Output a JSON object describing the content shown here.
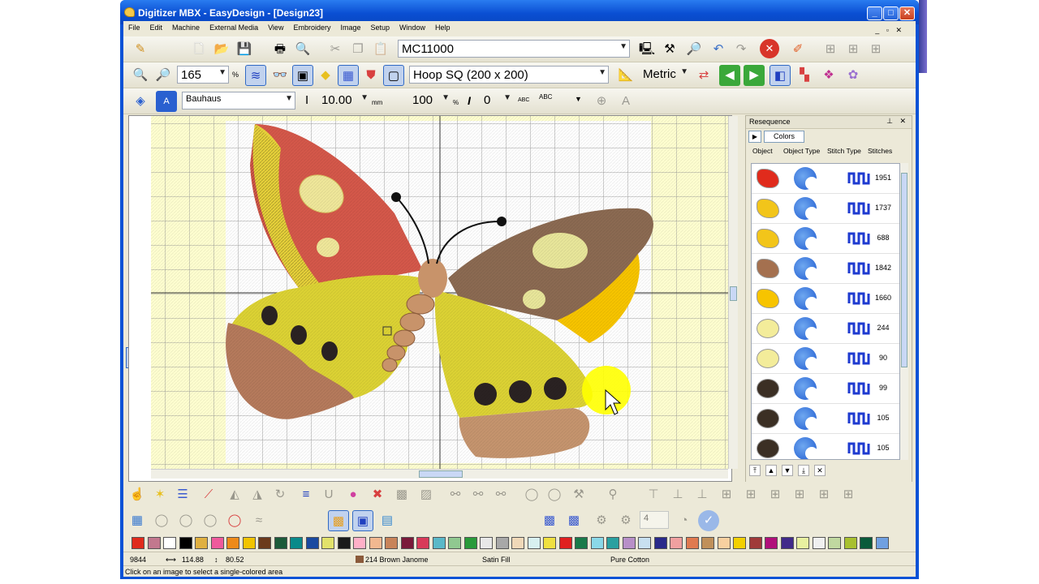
{
  "window": {
    "title": "Digitizer MBX - EasyDesign - [Design23]",
    "menu": [
      "File",
      "Edit",
      "Machine",
      "External Media",
      "View",
      "Embroidery",
      "Image",
      "Setup",
      "Window",
      "Help"
    ]
  },
  "toolbar": {
    "machine": "MC11000",
    "zoom": "165",
    "zoom_unit": "%",
    "hoop": "Hoop SQ (200 x 200)",
    "units": "Metric",
    "font": "Bauhaus",
    "letter_height": "10.00",
    "letter_height_unit": "mm",
    "letter_width": "100",
    "letter_width_unit": "%",
    "italic_label": "I",
    "italic_value": "0",
    "abc1": "ABC",
    "abc2": "ABC"
  },
  "panel": {
    "title": "Resequence",
    "tab": "Colors",
    "columns": [
      "Object",
      "Object Type",
      "Stitch Type",
      "Stitches"
    ],
    "rows": [
      {
        "stitches": "1951",
        "color": "#e02b1c"
      },
      {
        "stitches": "1737",
        "color": "#f2c51a"
      },
      {
        "stitches": "688",
        "color": "#f2c51a"
      },
      {
        "stitches": "1842",
        "color": "#a4704f"
      },
      {
        "stitches": "1660",
        "color": "#f7c400"
      },
      {
        "stitches": "244",
        "color": "#f3ec9a"
      },
      {
        "stitches": "90",
        "color": "#f3ec9a"
      },
      {
        "stitches": "99",
        "color": "#3b2f24"
      },
      {
        "stitches": "105",
        "color": "#3b2f24"
      },
      {
        "stitches": "105",
        "color": "#3b2f24"
      }
    ]
  },
  "palette": [
    "#e02b1c",
    "#c2788e",
    "#ffffff",
    "#000000",
    "#e0b040",
    "#ef5a9c",
    "#ee8a1a",
    "#f2c400",
    "#6b3a1c",
    "#1c5a3a",
    "#0a8a8a",
    "#1a4aa0",
    "#e2e26a",
    "#1a1a1a",
    "#ffb0c8",
    "#f2b890",
    "#c8845a",
    "#7a1a3a",
    "#d83a5a",
    "#5ab8c8",
    "#90c890",
    "#2a9a3a",
    "#e8e8e8",
    "#a8a8a8",
    "#f0d8b8",
    "#d8f0f0",
    "#f0e040",
    "#e02020",
    "#1a7a4a",
    "#8ad8e8",
    "#2aa0a0",
    "#b890c8",
    "#c8e0f0",
    "#2a2a8a",
    "#f0a0a0",
    "#e07a50",
    "#c0905a",
    "#f8d0a0",
    "#f2d000",
    "#a03a3a",
    "#b0107a",
    "#402a8a",
    "#e8f0a0",
    "#f0f0f0",
    "#c0d8a0",
    "#a8c030",
    "#0a5a3a",
    "#70a0e0"
  ],
  "status": {
    "stitches": "9844",
    "width": "114.88",
    "height": "80.52",
    "thread": "214 Brown Janome",
    "fill": "Satin Fill",
    "brand": "Pure Cotton",
    "hint": "Click on an image to select a single-colored area"
  },
  "colors": {
    "titlebar": "#0a52d6",
    "canvas_bg": "#ffffd0",
    "selection": "#316ac5"
  },
  "icons": [
    "pencil-icon",
    "new-icon",
    "open-icon",
    "save-icon",
    "print-icon",
    "preview-icon",
    "cut-icon",
    "copy-icon",
    "paste-icon",
    "undo-icon",
    "redo-icon",
    "stop-icon",
    "zoom-in-icon",
    "zoom-out-icon",
    "grid-icon",
    "hoop-icon",
    "pointer-icon",
    "magic-wand-icon"
  ]
}
